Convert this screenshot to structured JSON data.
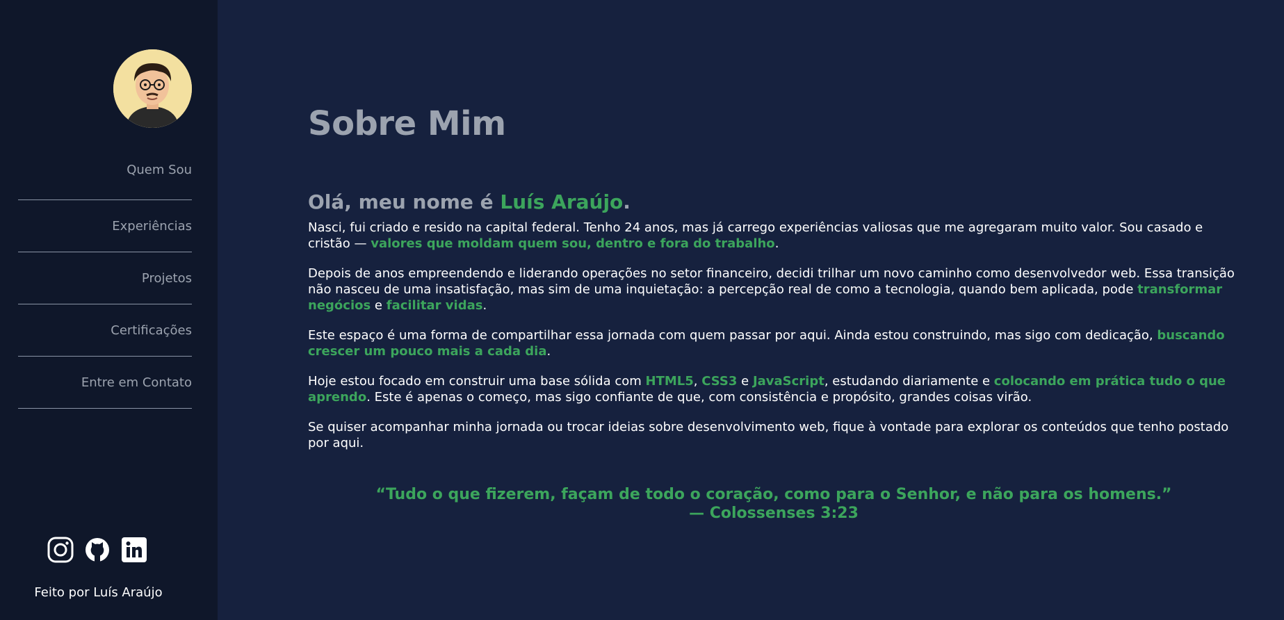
{
  "sidebar": {
    "nav": [
      {
        "label": "Quem Sou"
      },
      {
        "label": "Experiências"
      },
      {
        "label": "Projetos"
      },
      {
        "label": "Certificações"
      },
      {
        "label": "Entre em Contato"
      }
    ],
    "socials": [
      {
        "icon": "instagram-icon"
      },
      {
        "icon": "github-icon"
      },
      {
        "icon": "linkedin-icon"
      }
    ],
    "footer": "Feito por Luís Araújo"
  },
  "main": {
    "title": "Sobre Mim",
    "greeting": {
      "prefix": "Olá, meu nome é ",
      "name": "Luís Araújo",
      "suffix": "."
    },
    "p1": {
      "t1": "Nasci, fui criado e resido na capital federal. Tenho 24 anos, mas já carrego experiências valiosas que me agregaram muito valor. Sou casado e cristão — ",
      "h1": "valores que moldam quem sou, dentro e fora do trabalho",
      "t2": "."
    },
    "p2": {
      "t1": "Depois de anos empreendendo e liderando operações no setor financeiro, decidi trilhar um novo caminho como desenvolvedor web. Essa transição não nasceu de uma insatisfação, mas sim de uma inquietação: a percepção real de como a tecnologia, quando bem aplicada, pode ",
      "h1": "transformar negócios",
      "t2": " e ",
      "h2": "facilitar vidas",
      "t3": "."
    },
    "p3": {
      "t1": "Este espaço é uma forma de compartilhar essa jornada com quem passar por aqui. Ainda estou construindo, mas sigo com dedicação, ",
      "h1": "buscando crescer um pouco mais a cada dia",
      "t2": "."
    },
    "p4": {
      "t1": "Hoje estou focado em construir uma base sólida com ",
      "h1": "HTML5",
      "t2": ", ",
      "h2": "CSS3",
      "t3": " e ",
      "h3": "JavaScript",
      "t4": ", estudando diariamente e ",
      "h4": "colocando em prática tudo o que aprendo",
      "t5": ". Este é apenas o começo, mas sigo confiante de que, com consistência e propósito, grandes coisas virão."
    },
    "p5": "Se quiser acompanhar minha jornada ou trocar ideias sobre desenvolvimento web, fique à vontade para explorar os conteúdos que tenho postado por aqui.",
    "quote": {
      "text": "“Tudo o que fizerem, façam de todo o coração, como para o Senhor, e não para os homens.”",
      "ref": "— Colossenses 3:23"
    }
  },
  "colors": {
    "sidebar_bg": "#0f172a",
    "main_bg": "#16213e",
    "accent": "#3ca55c",
    "muted": "#9ca3af"
  }
}
